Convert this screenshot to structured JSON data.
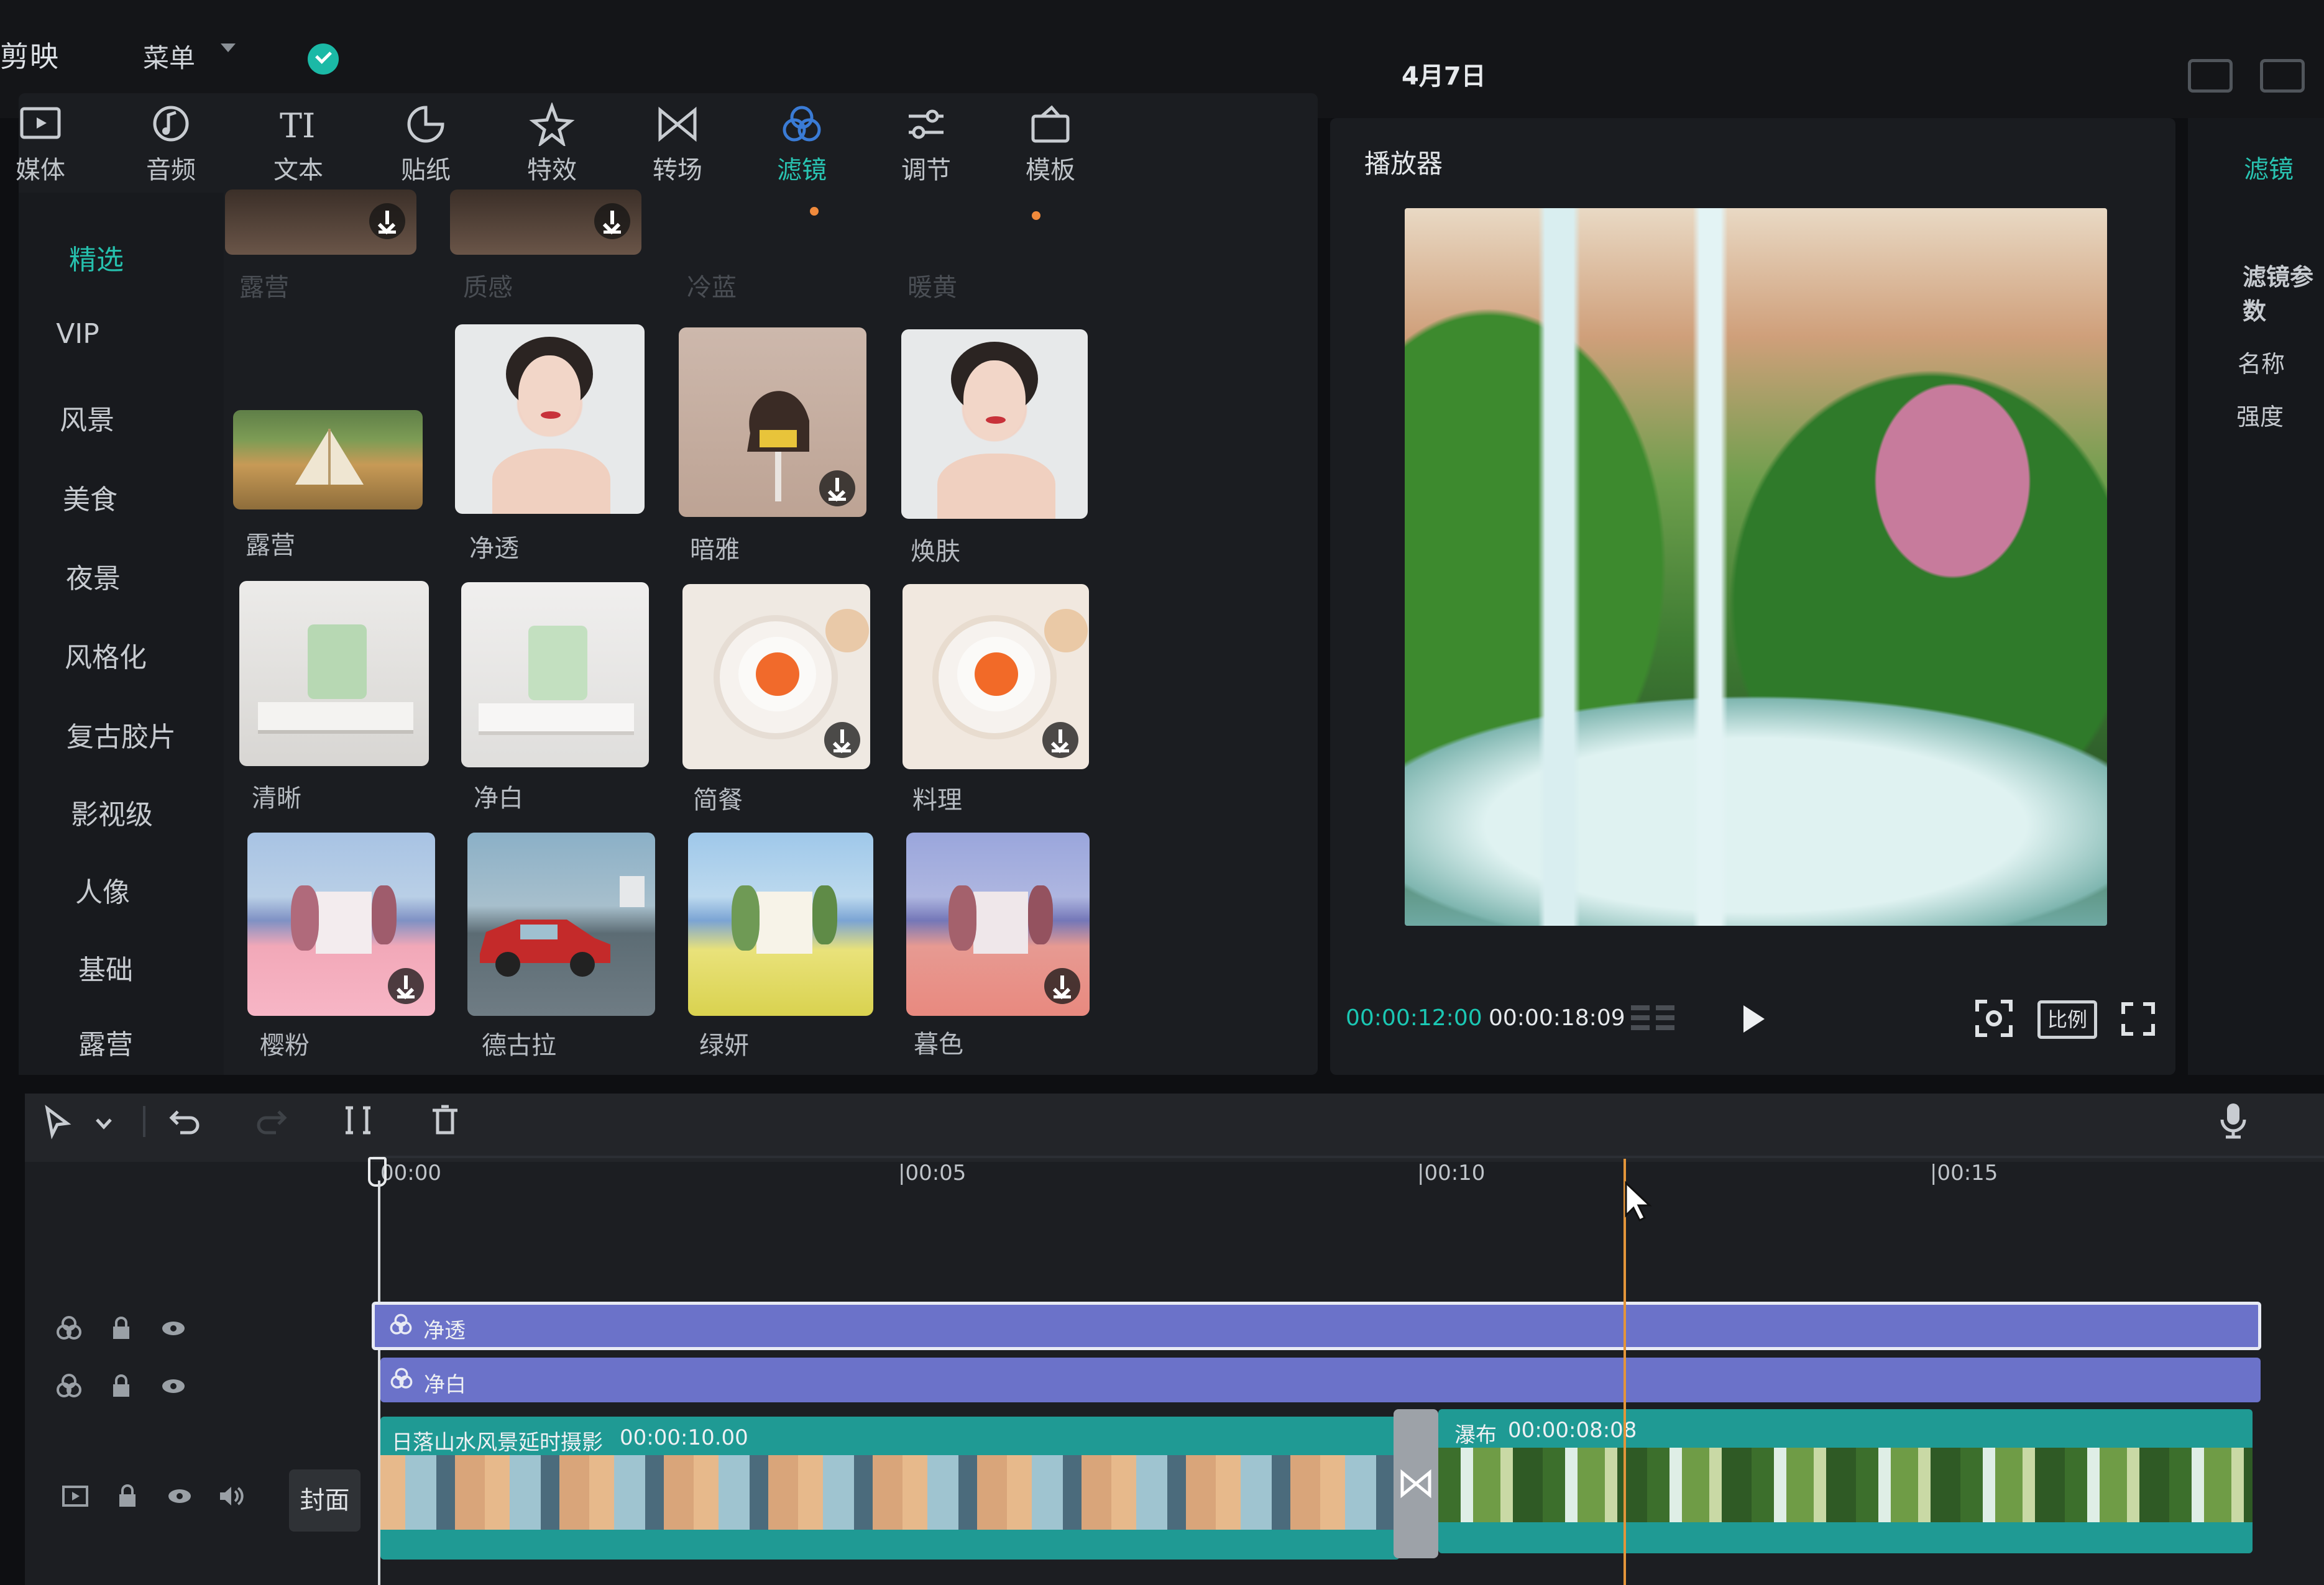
{
  "app": {
    "title": "剪映",
    "menu_label": "菜单"
  },
  "header": {
    "date": "4月7日"
  },
  "tabs": [
    {
      "label": "媒体",
      "icon": "media-icon"
    },
    {
      "label": "音频",
      "icon": "audio-icon"
    },
    {
      "label": "文本",
      "icon": "text-icon"
    },
    {
      "label": "贴纸",
      "icon": "sticker-icon"
    },
    {
      "label": "特效",
      "icon": "effect-icon"
    },
    {
      "label": "转场",
      "icon": "transition-icon"
    },
    {
      "label": "滤镜",
      "icon": "filter-icon",
      "active": true
    },
    {
      "label": "调节",
      "icon": "adjust-icon"
    },
    {
      "label": "模板",
      "icon": "template-icon"
    }
  ],
  "sidebar": {
    "items": [
      "精选",
      "VIP",
      "风景",
      "美食",
      "夜景",
      "风格化",
      "复古胶片",
      "影视级",
      "人像",
      "基础",
      "露营"
    ],
    "active_index": 0
  },
  "filters": {
    "partial_labels": [
      "露营",
      "质感",
      "冷蓝",
      "暖黄"
    ],
    "items": [
      {
        "label": "露营",
        "download": false
      },
      {
        "label": "净透",
        "download": false
      },
      {
        "label": "暗雅",
        "download": true
      },
      {
        "label": "焕肤",
        "download": false
      },
      {
        "label": "清晰",
        "download": false
      },
      {
        "label": "净白",
        "download": false
      },
      {
        "label": "简餐",
        "download": true
      },
      {
        "label": "料理",
        "download": true
      },
      {
        "label": "樱粉",
        "download": true
      },
      {
        "label": "德古拉",
        "download": false
      },
      {
        "label": "绿妍",
        "download": false
      },
      {
        "label": "暮色",
        "download": true
      }
    ]
  },
  "player": {
    "title": "播放器",
    "current_time": "00:00:12:00",
    "total_time": "00:00:18:09",
    "ratio_label": "比例"
  },
  "right_panel": {
    "tab": "滤镜",
    "section": "滤镜参数",
    "fields": [
      "名称",
      "强度"
    ]
  },
  "timeline": {
    "ruler": [
      "00:00",
      "|00:05",
      "|00:10",
      "|00:15"
    ],
    "playhead_fraction": 0.66,
    "tracks": [
      {
        "type": "filter",
        "label": "净透"
      },
      {
        "type": "filter",
        "label": "净白"
      }
    ],
    "clips": [
      {
        "name": "日落山水风景延时摄影",
        "duration": "00:00:10.00"
      },
      {
        "name": "瀑布",
        "duration": "00:00:08:08"
      }
    ],
    "cover_label": "封面"
  },
  "colors": {
    "accent": "#1bc7b3",
    "filter_track": "#6b72c9",
    "video_track": "#1f9a94",
    "playhead": "#e3953a"
  }
}
